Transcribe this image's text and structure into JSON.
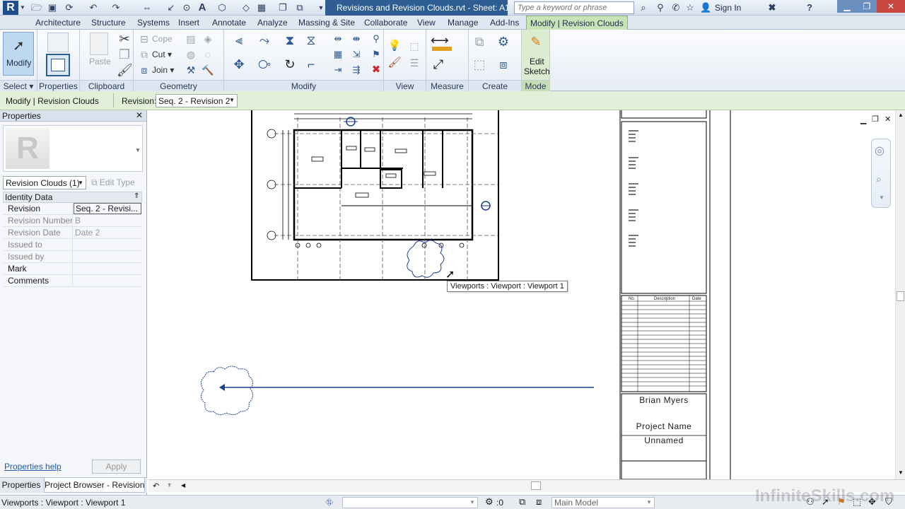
{
  "app": {
    "title": "Revisions and Revision Clouds.rvt - Sheet: A10...",
    "search_placeholder": "Type a keyword or phrase",
    "sign_in": "Sign In"
  },
  "tabs": [
    {
      "label": "Architecture"
    },
    {
      "label": "Structure"
    },
    {
      "label": "Systems"
    },
    {
      "label": "Insert"
    },
    {
      "label": "Annotate"
    },
    {
      "label": "Analyze"
    },
    {
      "label": "Massing & Site"
    },
    {
      "label": "Collaborate"
    },
    {
      "label": "View"
    },
    {
      "label": "Manage"
    },
    {
      "label": "Add-Ins"
    },
    {
      "label": "Modify | Revision Clouds",
      "active": true
    }
  ],
  "ribbon": {
    "modify_label": "Modify",
    "select_label": "Select",
    "properties_label": "Properties",
    "paste_label": "Paste",
    "clipboard_label": "Clipboard",
    "cope_label": "Cope",
    "cut_label": "Cut",
    "join_label": "Join",
    "geometry_label": "Geometry",
    "modify_panel_label": "Modify",
    "view_label": "View",
    "measure_label": "Measure",
    "create_label": "Create",
    "edit_label": "Edit",
    "sketch_label": "Sketch",
    "mode_label": "Mode"
  },
  "options_bar": {
    "context": "Modify | Revision Clouds",
    "revision_label": "Revision:",
    "revision_value": "Seq. 2 - Revision 2"
  },
  "properties": {
    "title": "Properties",
    "type_selector": "Revision Clouds (1)",
    "edit_type": "Edit Type",
    "group": "Identity Data",
    "rows": [
      {
        "key": "Revision",
        "value": "Seq. 2 - Revisi..."
      },
      {
        "key": "Revision Number",
        "value": "B"
      },
      {
        "key": "Revision Date",
        "value": "Date 2"
      },
      {
        "key": "Issued to",
        "value": ""
      },
      {
        "key": "Issued by",
        "value": ""
      },
      {
        "key": "Mark",
        "value": ""
      },
      {
        "key": "Comments",
        "value": ""
      }
    ],
    "help_link": "Properties help",
    "apply": "Apply",
    "bottom_tabs": [
      "Properties",
      "Project Browser - Revision..."
    ]
  },
  "canvas": {
    "tooltip": "Viewports : Viewport : Viewport 1",
    "title_block": {
      "name": "Brian Myers",
      "project_label": "Project Name",
      "project_value": "Unnamed",
      "schedule_headers": [
        "No.",
        "Description",
        "Date"
      ]
    }
  },
  "status": {
    "text": "Viewports : Viewport : Viewport 1",
    "coord": ":0",
    "model": "Main Model"
  },
  "watermark": "InfiniteSkills.com"
}
